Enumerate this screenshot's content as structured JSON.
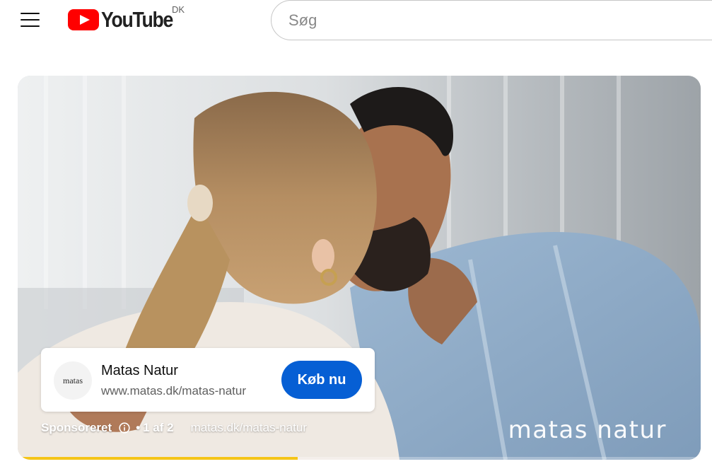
{
  "header": {
    "logo_text": "YouTube",
    "country_code": "DK",
    "search_placeholder": "Søg"
  },
  "player": {
    "brand_watermark": "matas natur",
    "ad": {
      "logo_text": "matas",
      "title": "Matas Natur",
      "url": "www.matas.dk/matas-natur",
      "cta_label": "Køb nu",
      "sponsored_label": "Sponsoreret",
      "position_text": "1 af 2",
      "link_text": "matas.dk/matas-natur"
    },
    "progress_fraction": 0.41
  },
  "colors": {
    "youtube_red": "#ff0000",
    "cta_blue": "#065fd4",
    "ad_progress": "#f5c518"
  }
}
